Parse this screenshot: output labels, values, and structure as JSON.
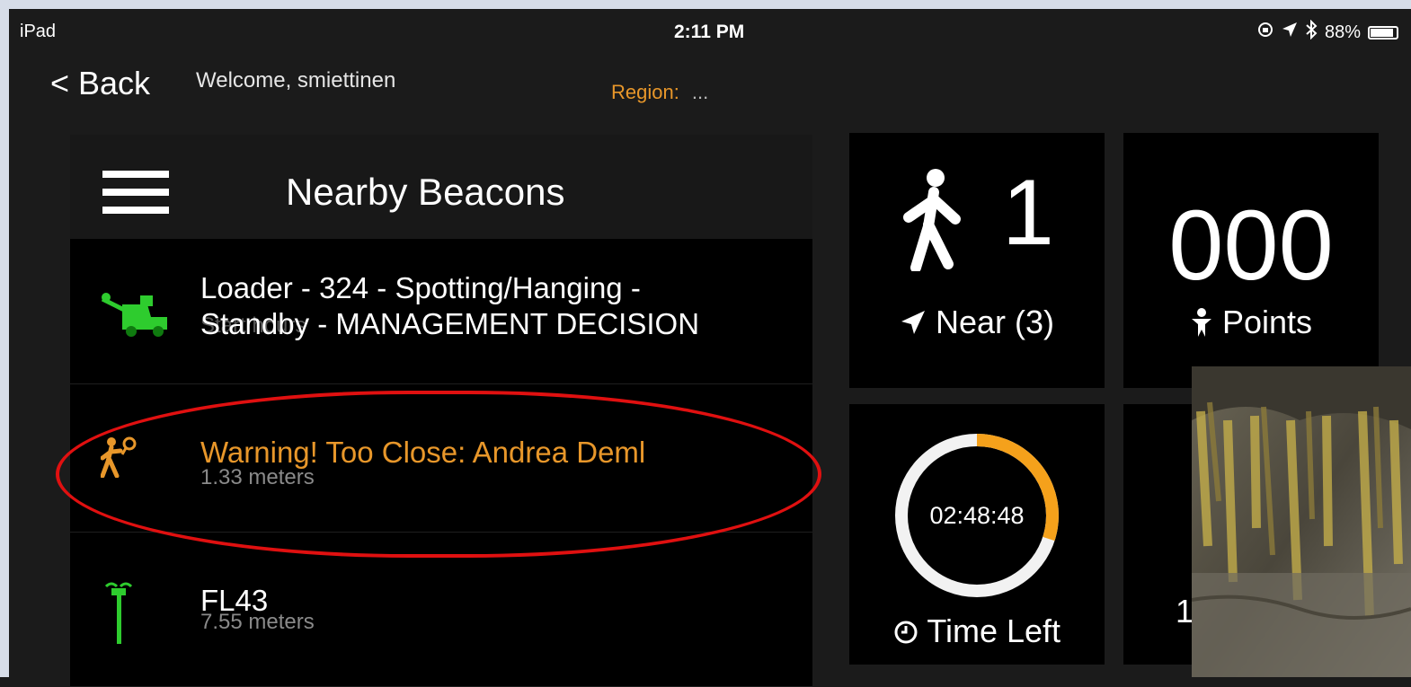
{
  "status_bar": {
    "device": "iPad",
    "time": "2:11 PM",
    "battery_text": "88%",
    "battery_level": 0.88
  },
  "header": {
    "back_label": "< Back",
    "welcome_text": "Welcome, smiettinen",
    "region_label": "Region:",
    "region_value": "..."
  },
  "beacons": {
    "title": "Nearby Beacons",
    "items": [
      {
        "title": "Loader - 324 - Spotting/Hanging -",
        "title_line2": "Standby - MANAGEMENT DECISION",
        "subtitle": "Start hours",
        "icon": "loader-icon",
        "color": "#2ecc2e"
      },
      {
        "title": "Warning! Too Close: Andrea Deml",
        "subtitle": "1.33 meters",
        "icon": "worker-icon",
        "color": "#e8972a"
      },
      {
        "title": "FL43",
        "subtitle": "7.55 meters",
        "icon": "antenna-icon",
        "color": "#2ecc2e"
      }
    ]
  },
  "stats": {
    "near_count": "1",
    "near_label": "Near (3)",
    "points_value": "000",
    "points_label": "Points",
    "timer": "02:48:48",
    "timer_progress": 0.3,
    "time_left_label": "Time Left",
    "fourth_tile_partial": "1"
  },
  "colors": {
    "accent": "#e8972a",
    "green": "#2ecc2e",
    "highlight": "#e01010"
  }
}
